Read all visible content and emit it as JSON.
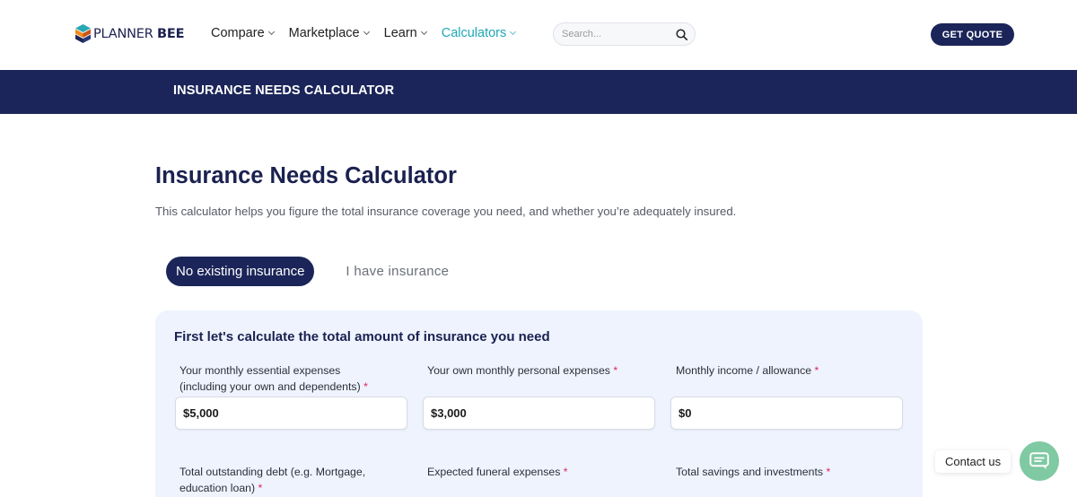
{
  "header": {
    "logo": {
      "part1": "PLANNER",
      "part2": "BEE"
    },
    "nav": [
      {
        "label": "Compare",
        "active": false
      },
      {
        "label": "Marketplace",
        "active": false
      },
      {
        "label": "Learn",
        "active": false
      },
      {
        "label": "Calculators",
        "active": true
      }
    ],
    "search": {
      "placeholder": "Search..."
    },
    "quote_label": "GET QUOTE"
  },
  "banner": {
    "title": "INSURANCE NEEDS CALCULATOR"
  },
  "main": {
    "title": "Insurance Needs Calculator",
    "description": "This calculator helps you figure the total insurance coverage you need, and whether you’re adequately insured.",
    "tabs": [
      {
        "label": "No existing insurance",
        "active": true
      },
      {
        "label": "I have insurance",
        "active": false
      }
    ],
    "card": {
      "title": "First let's calculate the total amount of insurance you need",
      "fields": [
        {
          "label_line1": "Your monthly essential expenses",
          "label_line2": "(including your own and dependents)",
          "required": "*",
          "value": "$5,000"
        },
        {
          "label_line1": "Your own monthly personal expenses",
          "required": "*",
          "value": "$3,000"
        },
        {
          "label_line1": "Monthly income / allowance",
          "required": "*",
          "value": "$0"
        },
        {
          "label_line1": "Total outstanding debt (e.g. Mortgage,",
          "label_line2": "education loan)",
          "required": "*"
        },
        {
          "label_line1": "Expected funeral expenses",
          "required": "*"
        },
        {
          "label_line1": "Total savings and investments",
          "required": "*"
        }
      ]
    }
  },
  "contact": {
    "label": "Contact us"
  },
  "colors": {
    "navy": "#1b2559",
    "accent": "#1fa8b6",
    "card_bg": "#eef3fd",
    "contact_green": "#7fc9a3",
    "required": "#e0245e"
  },
  "icons": [
    "logo-cube-icon",
    "chevron-down-icon",
    "search-icon",
    "chat-icon"
  ]
}
